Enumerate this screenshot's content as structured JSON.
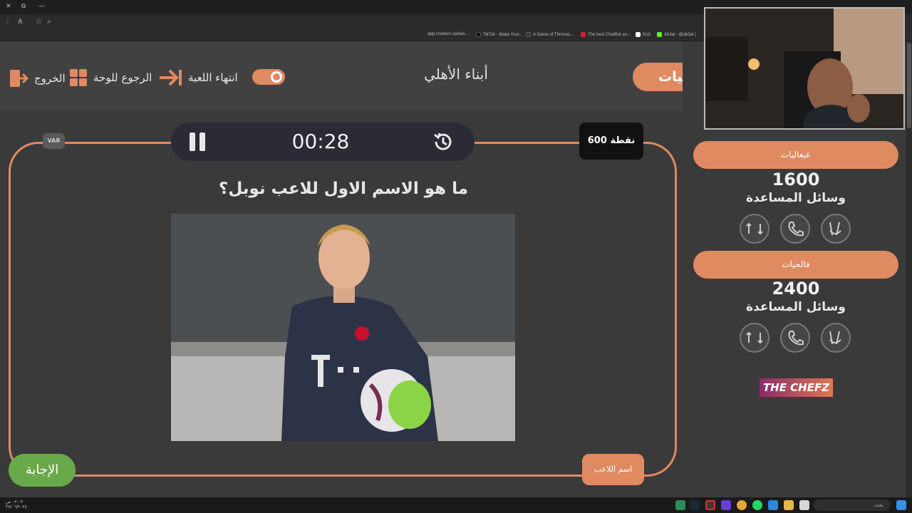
{
  "browser": {
    "bookmarks": [
      {
        "label": "app.creators.sa/das...",
        "color": "#3b5998"
      },
      {
        "label": "TikTok - Make Your...",
        "color": "#111111"
      },
      {
        "label": "A Game of Thrones...",
        "color": "#333333"
      },
      {
        "label": "The best ChatBot an...",
        "color": "#d01f2f"
      },
      {
        "label": "Kick",
        "color": "#53fc18"
      },
      {
        "label": "Ab3al - @ab3al |",
        "color": "#53fc18"
      }
    ]
  },
  "header": {
    "exit_label": "الخروج",
    "back_label": "الرجوع للوحة",
    "end_game_label": "انتهاء اللعبة",
    "team_name": "أبناء الأهلي",
    "active_team_tab": "عبعاليات"
  },
  "game": {
    "var_label": "VAR",
    "timer": "00:28",
    "points_label": "600 نقطة",
    "question": "ما هو الاسم الاول للاعب نوبل؟",
    "answer_label": "الإجابة",
    "player_name_label": "اسم اللاعب"
  },
  "teams": [
    {
      "name": "عبعاليات",
      "score": "1600",
      "helpers_label": "وسائل المساعدة"
    },
    {
      "name": "فالحيات",
      "score": "2400",
      "helpers_label": "وسائل المساعدة"
    }
  ],
  "logo": {
    "text": "THE CHEFZ"
  },
  "taskbar": {
    "search_placeholder": "بحث",
    "time": "٠٢:٠٣ ص",
    "date": "٢٧/٠٦/٢٠٢٤"
  }
}
